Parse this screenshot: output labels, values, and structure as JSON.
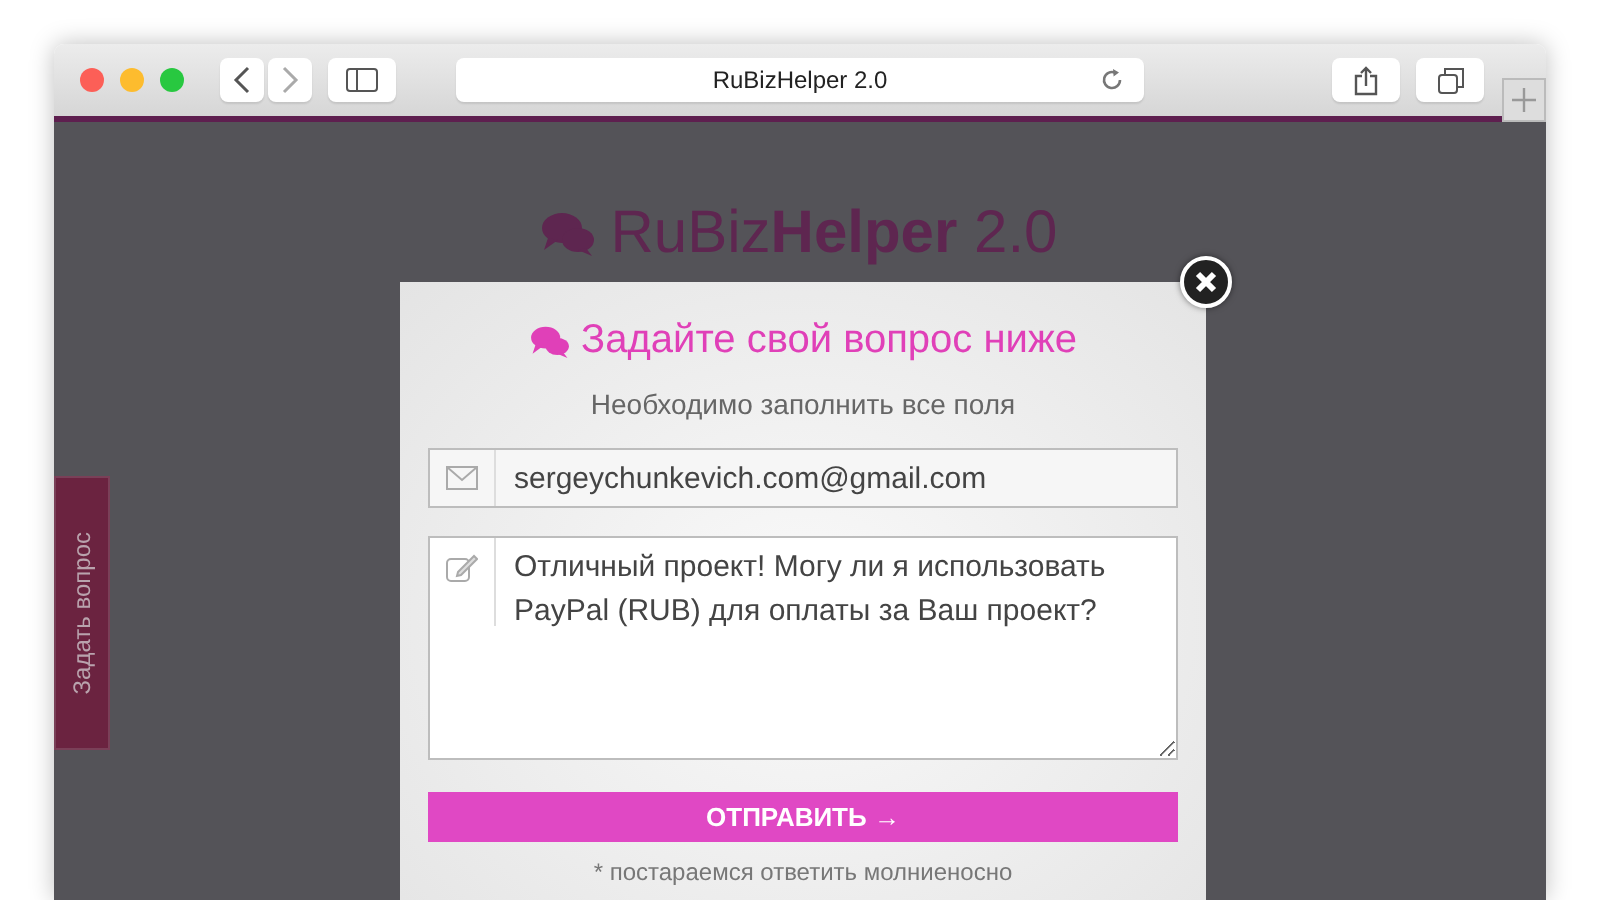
{
  "browser": {
    "address": "RuBizHelper 2.0"
  },
  "logo": {
    "light": "RuBiz",
    "bold": "Helper",
    "version": "2.0"
  },
  "side_tab": {
    "label": "Задать вопрос"
  },
  "modal": {
    "title": "Задайте свой вопрос ниже",
    "subtitle": "Необходимо заполнить все поля",
    "email": "sergeychunkevich.com@gmail.com",
    "message": "Отличный проект! Могу ли я использовать PayPal (RUB) для оплаты за Ваш проект?",
    "submit": "ОТПРАВИТЬ →",
    "note": "* постараемся ответить молниеносно"
  }
}
